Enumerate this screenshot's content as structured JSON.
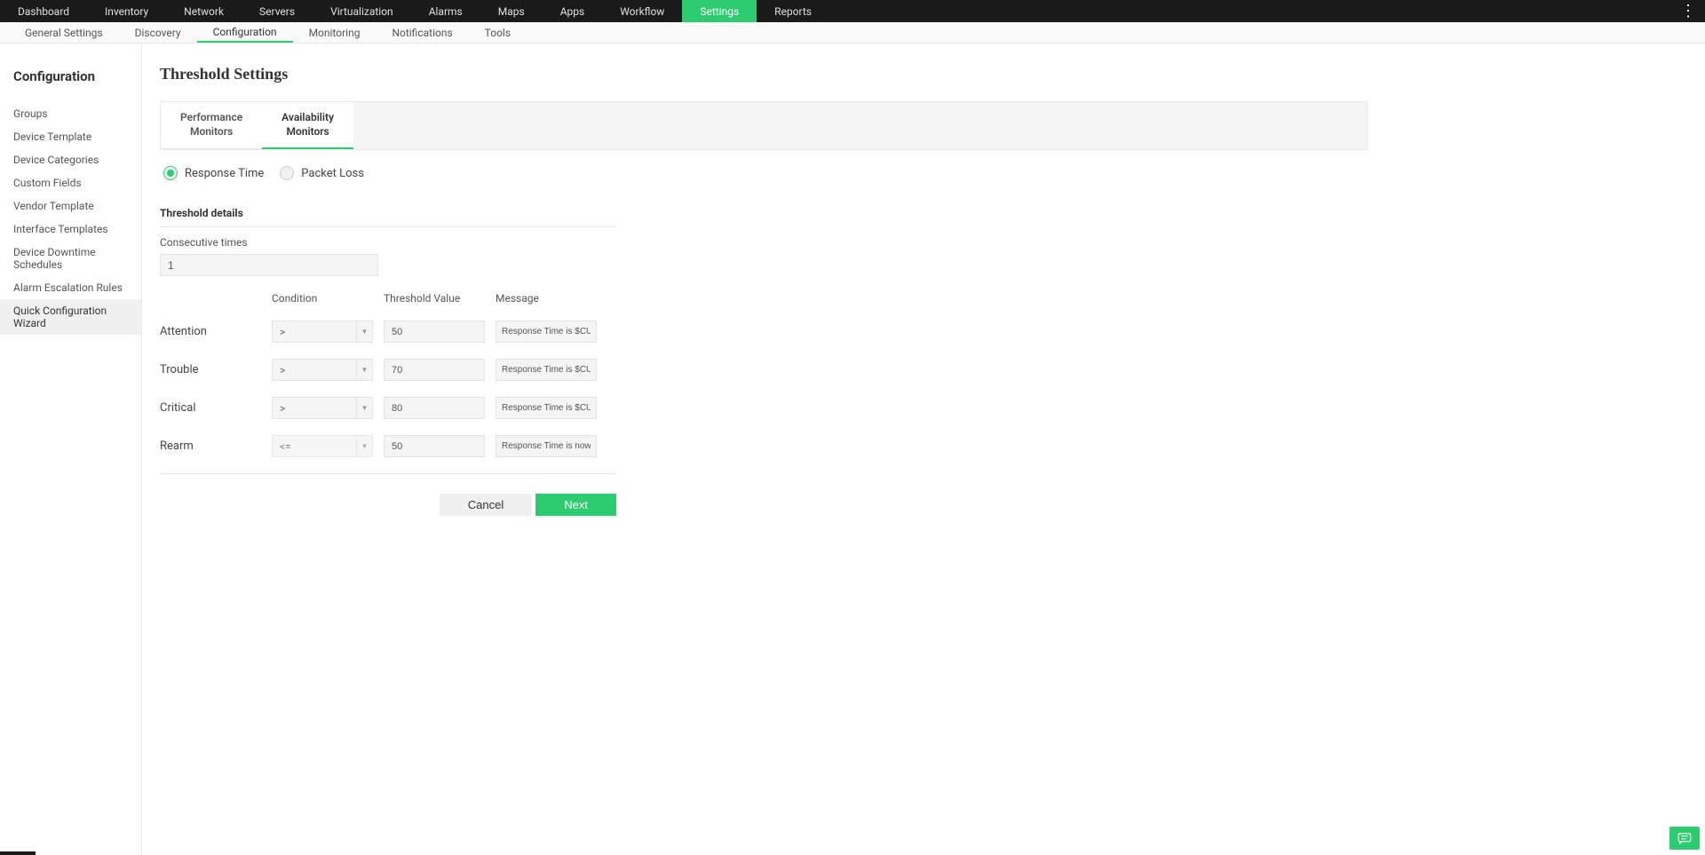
{
  "topNav": {
    "items": [
      {
        "label": "Dashboard",
        "active": false
      },
      {
        "label": "Inventory",
        "active": false
      },
      {
        "label": "Network",
        "active": false
      },
      {
        "label": "Servers",
        "active": false
      },
      {
        "label": "Virtualization",
        "active": false
      },
      {
        "label": "Alarms",
        "active": false
      },
      {
        "label": "Maps",
        "active": false
      },
      {
        "label": "Apps",
        "active": false
      },
      {
        "label": "Workflow",
        "active": false
      },
      {
        "label": "Settings",
        "active": true
      },
      {
        "label": "Reports",
        "active": false
      }
    ]
  },
  "subNav": {
    "items": [
      {
        "label": "General Settings",
        "active": false
      },
      {
        "label": "Discovery",
        "active": false
      },
      {
        "label": "Configuration",
        "active": true
      },
      {
        "label": "Monitoring",
        "active": false
      },
      {
        "label": "Notifications",
        "active": false
      },
      {
        "label": "Tools",
        "active": false
      }
    ]
  },
  "sidebar": {
    "title": "Configuration",
    "items": [
      {
        "label": "Groups",
        "active": false
      },
      {
        "label": "Device Template",
        "active": false
      },
      {
        "label": "Device Categories",
        "active": false
      },
      {
        "label": "Custom Fields",
        "active": false
      },
      {
        "label": "Vendor Template",
        "active": false
      },
      {
        "label": "Interface Templates",
        "active": false
      },
      {
        "label": "Device Downtime Schedules",
        "active": false
      },
      {
        "label": "Alarm Escalation Rules",
        "active": false
      },
      {
        "label": "Quick Configuration Wizard",
        "active": true
      }
    ]
  },
  "page": {
    "title": "Threshold Settings"
  },
  "tabs": [
    {
      "label": "Performance\nMonitors",
      "active": false
    },
    {
      "label": "Availability\nMonitors",
      "active": true
    }
  ],
  "radios": [
    {
      "label": "Response Time",
      "checked": true
    },
    {
      "label": "Packet Loss",
      "checked": false
    }
  ],
  "thresholdSection": {
    "title": "Threshold details",
    "consecutiveLabel": "Consecutive times",
    "consecutiveValue": "1",
    "headers": {
      "condition": "Condition",
      "value": "Threshold Value",
      "message": "Message"
    },
    "rows": [
      {
        "label": "Attention",
        "condition": ">",
        "value": "50",
        "message": "Response Time is $CURREI",
        "disabled": false
      },
      {
        "label": "Trouble",
        "condition": ">",
        "value": "70",
        "message": "Response Time is $CURREI",
        "disabled": false
      },
      {
        "label": "Critical",
        "condition": ">",
        "value": "80",
        "message": "Response Time is $CURREI",
        "disabled": false
      },
      {
        "label": "Rearm",
        "condition": "<=",
        "value": "50",
        "message": "Response Time is now bac",
        "disabled": true
      }
    ]
  },
  "buttons": {
    "cancel": "Cancel",
    "next": "Next"
  }
}
